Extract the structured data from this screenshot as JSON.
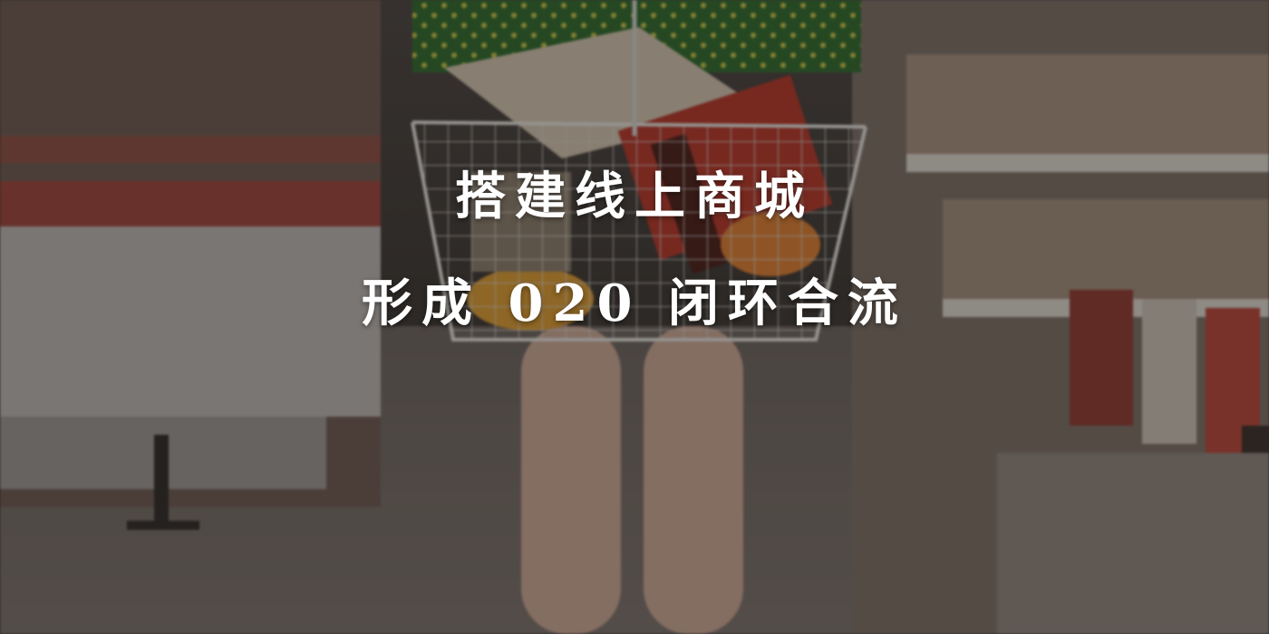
{
  "banner": {
    "line1": "搭建线上商城",
    "line2": "形成 020 闭环合流"
  },
  "colors": {
    "overlay": "#2a2523",
    "text": "#ffffff",
    "dress_green": "#2f6a2e",
    "dot_yellow": "#c8c24a",
    "basket_wire": "#d8d6d2",
    "package_red": "#b3372b",
    "produce_orange": "#d99a33",
    "skin": "#c9a593"
  }
}
